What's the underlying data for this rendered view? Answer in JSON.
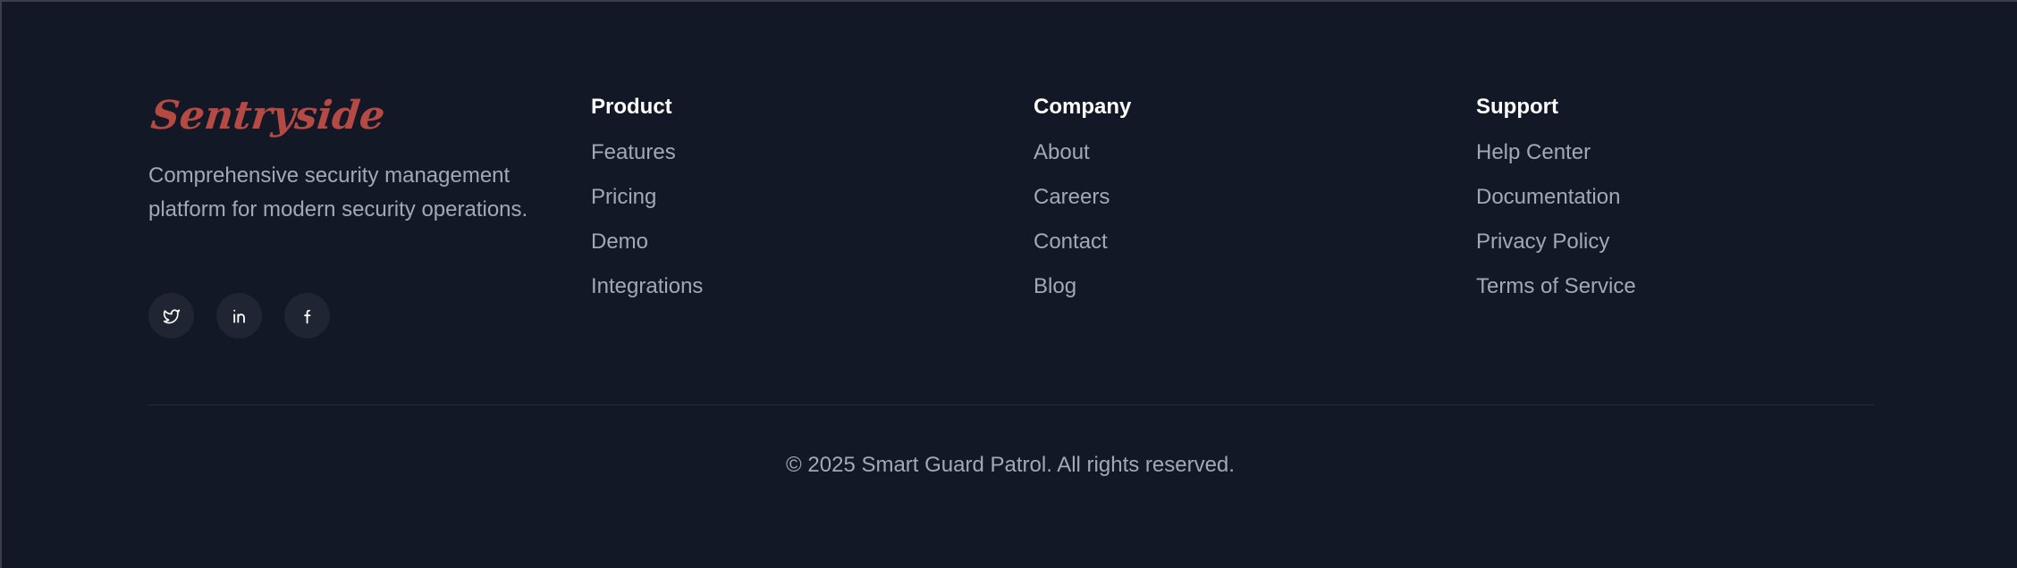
{
  "brand": {
    "name": "Sentryside",
    "tagline": "Comprehensive security management platform for modern security operations.",
    "color": "#b54a45"
  },
  "socials": [
    {
      "icon": "twitter-icon",
      "label": "Twitter"
    },
    {
      "icon": "linkedin-icon",
      "label": "LinkedIn"
    },
    {
      "icon": "facebook-icon",
      "label": "Facebook"
    }
  ],
  "columns": {
    "product": {
      "title": "Product",
      "links": [
        "Features",
        "Pricing",
        "Demo",
        "Integrations"
      ]
    },
    "company": {
      "title": "Company",
      "links": [
        "About",
        "Careers",
        "Contact",
        "Blog"
      ]
    },
    "support": {
      "title": "Support",
      "links": [
        "Help Center",
        "Documentation",
        "Privacy Policy",
        "Terms of Service"
      ]
    }
  },
  "copyright": "© 2025 Smart Guard Patrol. All rights reserved.",
  "colors": {
    "background": "#121826",
    "heading": "#ffffff",
    "text": "#a3a9b4",
    "social_bg": "#1f2533"
  }
}
